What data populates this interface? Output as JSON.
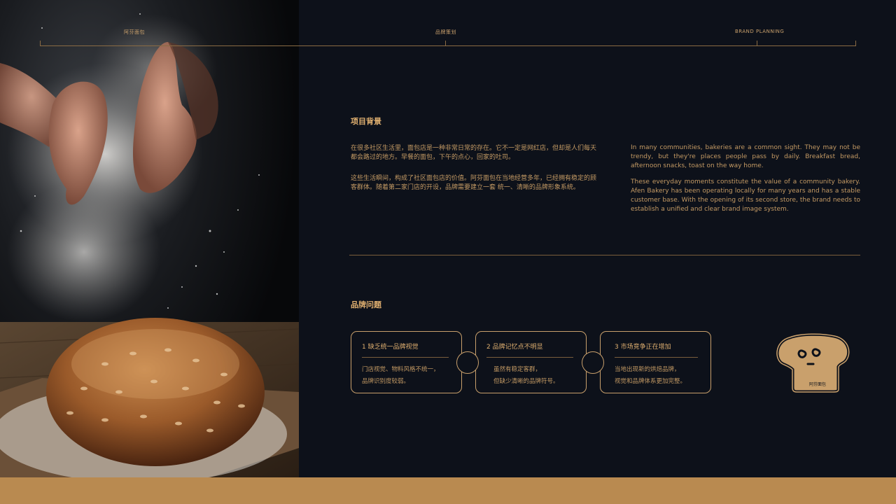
{
  "header": {
    "left": "阿芬面包",
    "center": "品牌策划",
    "right": "BRAND PLANNING"
  },
  "background": {
    "title": "项目背景",
    "cn": [
      "在很多社区生活里，面包店是一种非常日常的存在。它不一定是网红店，但却是人们每天都会路过的地方。早餐的面包，下午的点心，回家的吐司。",
      "这些生活瞬间，构成了社区面包店的价值。阿芬面包在当地经营多年，已经拥有稳定的顾客群体。随着第二家门店的开设，品牌需要建立一套 统一、清晰的品牌形象系统。"
    ],
    "en": [
      "In many communities, bakeries are a common sight. They may not be trendy, but they're places people pass by daily. Breakfast bread, afternoon snacks, toast on the way home.",
      "These everyday moments constitute the value of a community bakery. Afen Bakery has been operating locally for many years and has a stable customer base. With the opening of its second store, the brand needs to establish a unified and clear brand image system."
    ]
  },
  "issues": {
    "title": "品牌问题",
    "cards": [
      {
        "title": "1 缺乏统一品牌视觉",
        "line1": "门店视觉、物料风格不统一，",
        "line2": "品牌识别度较弱。"
      },
      {
        "title": "2 品牌记忆点不明显",
        "line1": "虽然有稳定客群，",
        "line2": "但缺少清晰的品牌符号。"
      },
      {
        "title": "3 市场竞争正在增加",
        "line1": "当地出现新的烘焙品牌，",
        "line2": "视觉和品牌体系更加完整。"
      }
    ]
  },
  "logo": {
    "text": "阿芬面包"
  },
  "colors": {
    "accent": "#c9a06c",
    "background": "#0d111a",
    "band": "#b98a50"
  }
}
